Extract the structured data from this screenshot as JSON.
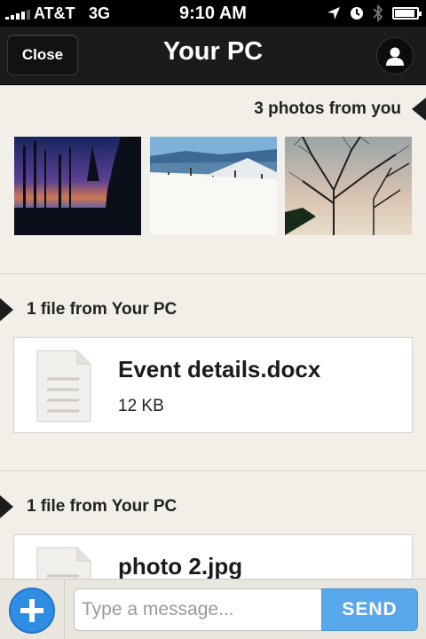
{
  "status_bar": {
    "carrier": "AT&T",
    "network": "3G",
    "time": "9:10 AM",
    "icons": [
      "signal-icon",
      "location-icon",
      "clock-icon",
      "bluetooth-icon",
      "battery-icon"
    ]
  },
  "nav": {
    "close_label": "Close",
    "title": "Your PC",
    "profile_icon": "person-icon"
  },
  "photos_section": {
    "heading": "3 photos from you",
    "photos": [
      {
        "name": "sunset-forest-photo"
      },
      {
        "name": "snowy-lake-photo"
      },
      {
        "name": "bare-tree-photo"
      }
    ]
  },
  "file_sections": [
    {
      "heading": "1 file from Your PC",
      "file_name": "Event details.docx",
      "file_size": "12 KB",
      "icon": "document-icon"
    },
    {
      "heading": "1 file from Your PC",
      "file_name": "photo 2.jpg",
      "file_size": "",
      "icon": "document-icon"
    }
  ],
  "composer": {
    "add_icon": "plus-icon",
    "placeholder": "Type a message...",
    "value": "",
    "send_label": "SEND"
  },
  "colors": {
    "background": "#f2efe9",
    "nav_bar": "#1b1b1b",
    "accent_blue": "#2f8de4",
    "send_blue": "#5aa8ec"
  }
}
